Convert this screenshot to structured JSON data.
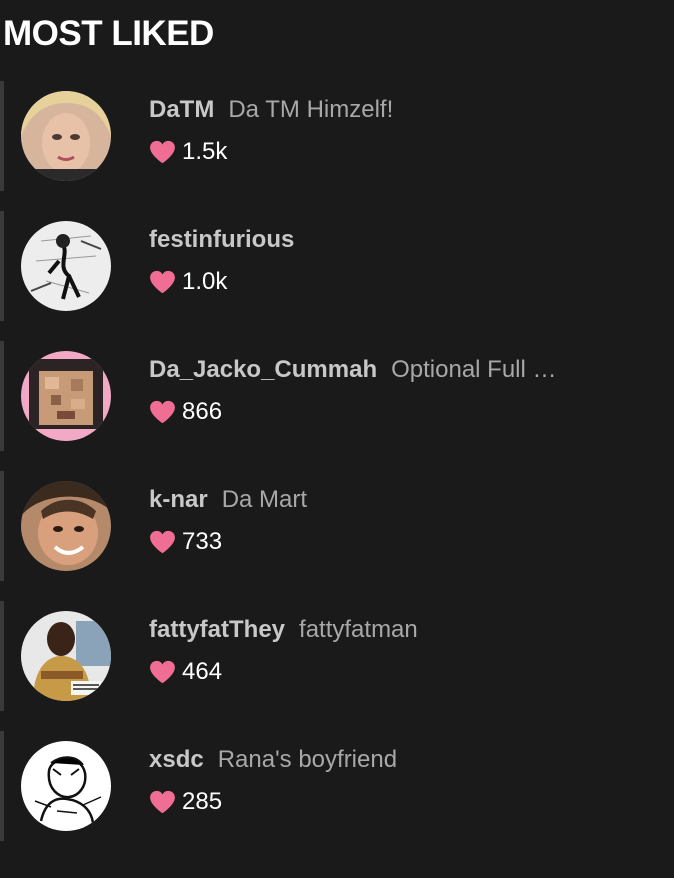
{
  "section": {
    "title": "MOST LIKED"
  },
  "colors": {
    "background": "#1a1a1a",
    "heart": "#f06d94",
    "username": "#c8c8c8",
    "fullname": "#a8a8a8"
  },
  "users": [
    {
      "username": "DaTM",
      "fullname": "Da TM Himzelf!",
      "likes": "1.5k"
    },
    {
      "username": "festinfurious",
      "fullname": "",
      "likes": "1.0k"
    },
    {
      "username": "Da_Jacko_Cummah",
      "fullname": "Optional Full …",
      "likes": "866"
    },
    {
      "username": "k-nar",
      "fullname": "Da Mart",
      "likes": "733"
    },
    {
      "username": "fattyfatThey",
      "fullname": "fattyfatman",
      "likes": "464"
    },
    {
      "username": "xsdc",
      "fullname": "Rana's boyfriend",
      "likes": "285"
    }
  ]
}
